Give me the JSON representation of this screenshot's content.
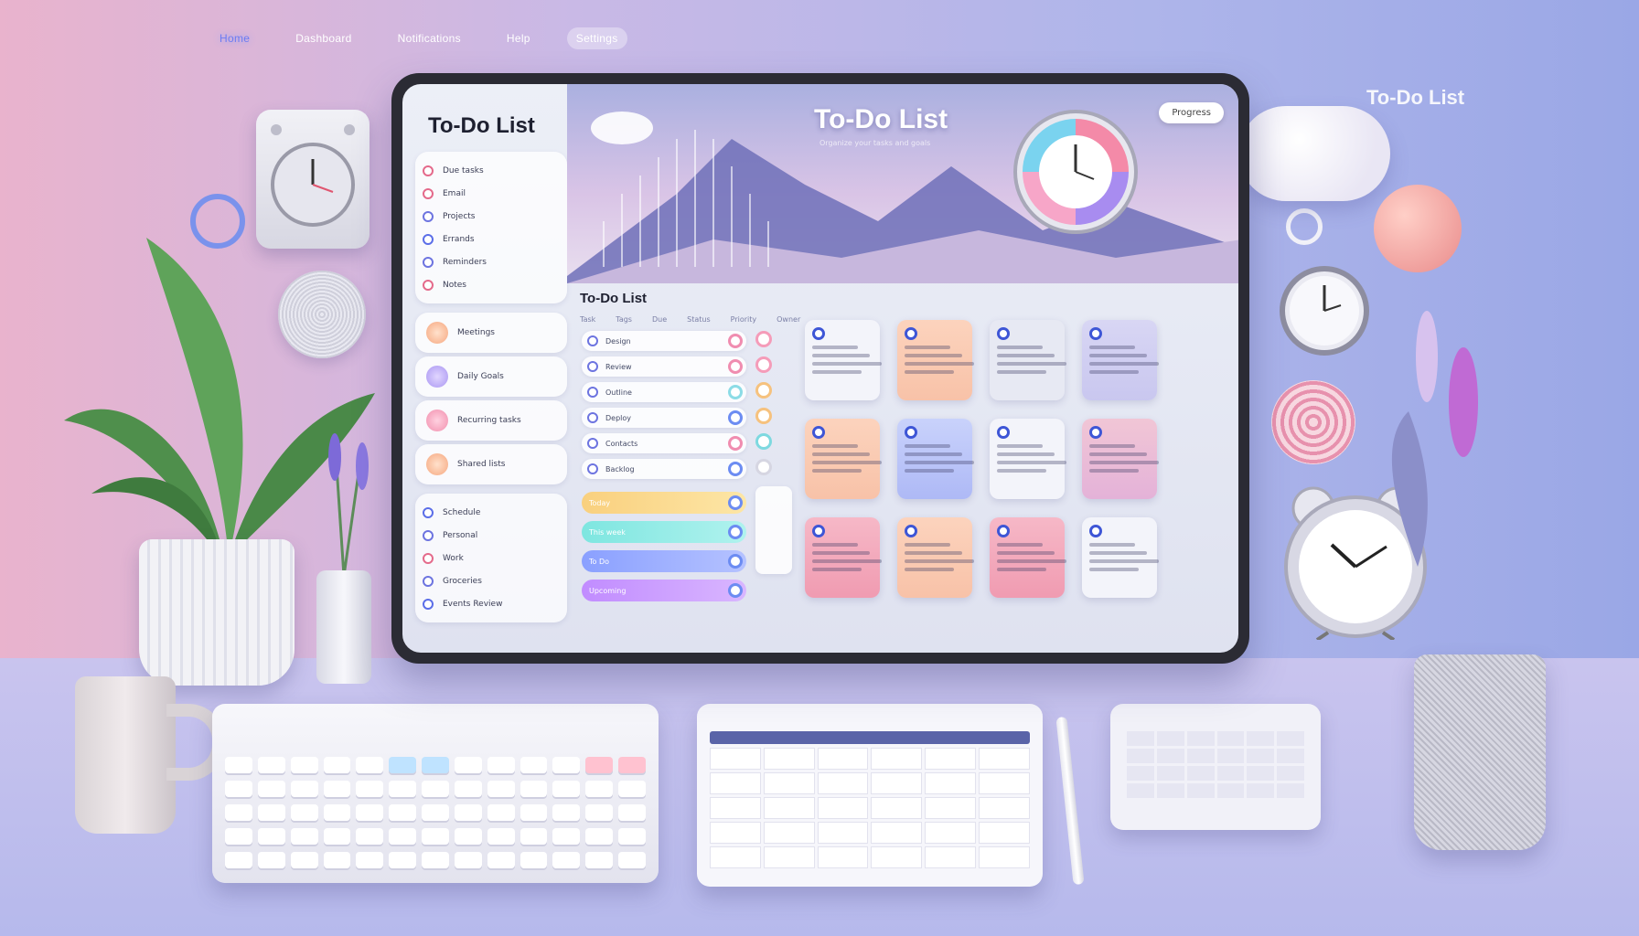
{
  "nav": {
    "items": [
      "Home",
      "Dashboard",
      "Notifications",
      "Help",
      "Settings"
    ],
    "active_index": 0
  },
  "floating_title": "To-Do List",
  "sidebar": {
    "title": "To-Do List",
    "list_items": [
      "Due tasks",
      "Email",
      "Projects",
      "Errands",
      "Reminders",
      "Notes"
    ],
    "pills": [
      {
        "label": "Meetings"
      },
      {
        "label": "Daily Goals"
      },
      {
        "label": "Recurring tasks"
      },
      {
        "label": "Shared lists"
      }
    ],
    "bottom_items": [
      "Schedule",
      "Personal",
      "Work",
      "Groceries",
      "Events Review"
    ]
  },
  "hero": {
    "title": "To-Do List",
    "subtitle": "Organize your tasks and goals",
    "button_label": "Progress"
  },
  "main": {
    "title": "To-Do List",
    "column_headers": [
      "Task",
      "Tags",
      "Due",
      "Status",
      "Priority",
      "Owner"
    ],
    "tasks": [
      "Design",
      "Review",
      "Outline",
      "Deploy",
      "Contacts",
      "Backlog"
    ],
    "bars": [
      "Today",
      "This week",
      "To Do",
      "Upcoming"
    ]
  },
  "colors": {
    "accent": "#6c7cf2",
    "card_pin": "#3e56d6",
    "pink": "#f09bb1",
    "peach": "#f8c2a8",
    "lavender": "#c9c7ef"
  },
  "cards": [
    {
      "color": "c-white"
    },
    {
      "color": "c-peach"
    },
    {
      "color": "c-grey"
    },
    {
      "color": "c-lav"
    },
    {
      "color": "c-peach"
    },
    {
      "color": "c-blue"
    },
    {
      "color": "c-white"
    },
    {
      "color": "c-rose"
    },
    {
      "color": "c-pink"
    },
    {
      "color": "c-peach"
    },
    {
      "color": "c-pink"
    },
    {
      "color": "c-white"
    }
  ]
}
